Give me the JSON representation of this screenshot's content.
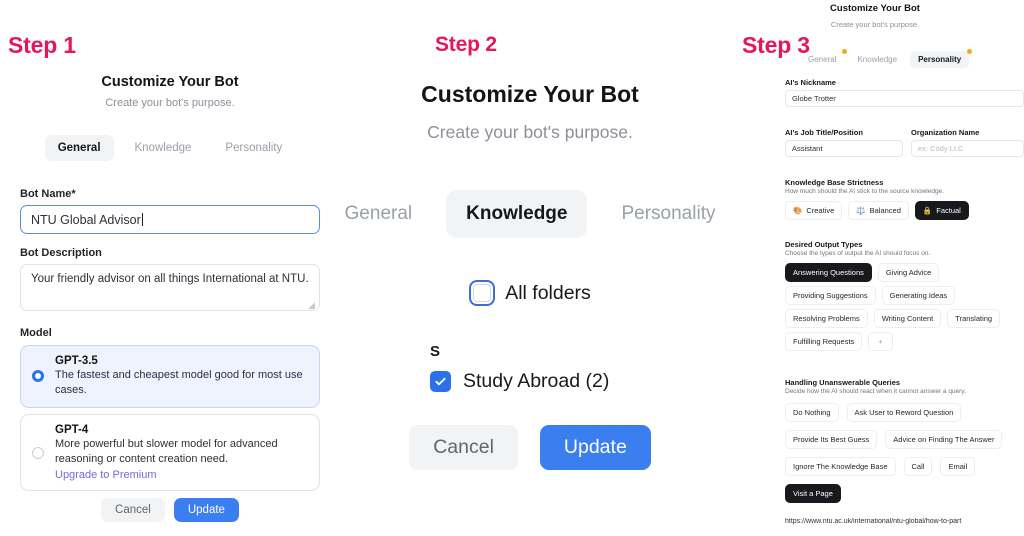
{
  "steps": {
    "one": "Step 1",
    "two": "Step 2",
    "three": "Step 3"
  },
  "modal": {
    "title": "Customize Your Bot",
    "subtitle": "Create your bot's purpose."
  },
  "tabs": {
    "general": "General",
    "knowledge": "Knowledge",
    "personality": "Personality"
  },
  "step1": {
    "bot_name_label": "Bot Name*",
    "bot_name_value": "NTU Global Advisor",
    "bot_description_label": "Bot Description",
    "bot_description_value": "Your friendly advisor on all things International at NTU.",
    "model_label": "Model",
    "models": [
      {
        "name": "GPT-3.5",
        "description": "The fastest and cheapest model good for most use cases.",
        "selected": true
      },
      {
        "name": "GPT-4",
        "description": "More powerful but slower model for advanced reasoning or content creation need.",
        "link": "Upgrade to Premium",
        "selected": false
      }
    ],
    "cancel_label": "Cancel",
    "update_label": "Update"
  },
  "step2": {
    "all_folders_label": "All folders",
    "group_letter": "S",
    "folder_label": "Study Abroad (2)",
    "cancel_label": "Cancel",
    "update_label": "Update"
  },
  "step3": {
    "nickname_label": "AI's Nickname",
    "nickname_value": "Globe Trotter",
    "job_title_label": "AI's Job Title/Position",
    "job_title_value": "Assistant",
    "organization_label": "Organization Name",
    "organization_placeholder": "ex: Cody LLC",
    "strictness_label": "Knowledge Base Strictness",
    "strictness_hint": "How much should the AI stick to the source knowledge.",
    "strictness_options": [
      {
        "label": "Creative",
        "emoji": "🎨",
        "selected": false
      },
      {
        "label": "Balanced",
        "emoji": "⚖️",
        "selected": false
      },
      {
        "label": "Factual",
        "emoji": "🔒",
        "selected": true
      }
    ],
    "output_types_label": "Desired Output Types",
    "output_types_hint": "Choose the types of output the AI should focus on.",
    "output_types": [
      {
        "label": "Answering Questions",
        "selected": true
      },
      {
        "label": "Giving Advice",
        "selected": false
      },
      {
        "label": "Providing Suggestions",
        "selected": false
      },
      {
        "label": "Generating Ideas",
        "selected": false
      },
      {
        "label": "Resolving Problems",
        "selected": false
      },
      {
        "label": "Writing Content",
        "selected": false
      },
      {
        "label": "Translating",
        "selected": false
      },
      {
        "label": "Fulfilling Requests",
        "selected": false
      },
      {
        "label": "+",
        "selected": false,
        "is_add": true
      }
    ],
    "unanswerable_label": "Handling Unanswerable Queries",
    "unanswerable_hint": "Decide how the AI should react when it cannot answer a query.",
    "unanswerable_options": [
      {
        "label": "Do Nothing",
        "selected": false
      },
      {
        "label": "Ask User to Reword Question",
        "selected": false
      },
      {
        "label": "Provide Its Best Guess",
        "selected": false
      },
      {
        "label": "Advice on Finding The Answer",
        "selected": false
      },
      {
        "label": "Ignore The Knowledge Base",
        "selected": false
      },
      {
        "label": "Call",
        "selected": false
      },
      {
        "label": "Email",
        "selected": false
      },
      {
        "label": "Visit a Page",
        "selected": true
      }
    ],
    "url_value": "https://www.ntu.ac.uk/international/ntu-global/how-to-part"
  },
  "colors": {
    "step_pink": "#e4175c",
    "primary_blue": "#3b7ef0",
    "chip_selected": "#17191d",
    "badge_orange": "#f5a623"
  }
}
